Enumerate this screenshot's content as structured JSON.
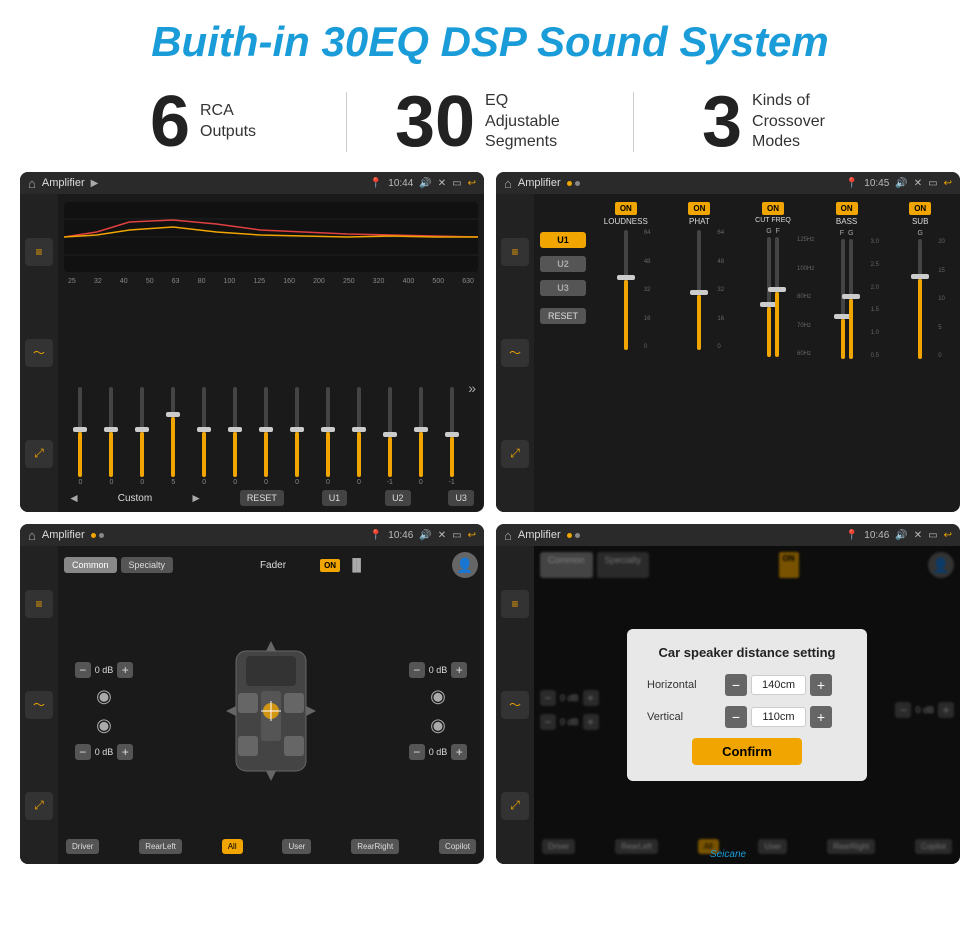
{
  "title": "Buith-in 30EQ DSP Sound System",
  "stats": [
    {
      "number": "6",
      "label": "RCA\nOutputs"
    },
    {
      "number": "30",
      "label": "EQ Adjustable\nSegments"
    },
    {
      "number": "3",
      "label": "Kinds of\nCrossover Modes"
    }
  ],
  "screen1": {
    "status_title": "Amplifier",
    "time": "10:44",
    "freq_labels": [
      "25",
      "32",
      "40",
      "50",
      "63",
      "80",
      "100",
      "125",
      "160",
      "200",
      "250",
      "320",
      "400",
      "500",
      "630"
    ],
    "slider_values": [
      "0",
      "0",
      "0",
      "5",
      "0",
      "0",
      "0",
      "0",
      "0",
      "0",
      "-1",
      "0",
      "-1"
    ],
    "bottom_btns": [
      "RESET",
      "U1",
      "U2",
      "U3"
    ],
    "eq_label": "Custom"
  },
  "screen2": {
    "status_title": "Amplifier",
    "time": "10:45",
    "u_labels": [
      "U1",
      "U2",
      "U3"
    ],
    "params": [
      "LOUDNESS",
      "PHAT",
      "CUT FREQ",
      "BASS",
      "SUB"
    ],
    "reset_label": "RESET"
  },
  "screen3": {
    "status_title": "Amplifier",
    "time": "10:46",
    "tabs": [
      "Common",
      "Specialty"
    ],
    "fader_label": "Fader",
    "on_label": "ON",
    "zones": [
      "Driver",
      "RearLeft",
      "All",
      "User",
      "RearRight",
      "Copilot"
    ],
    "vol_labels": [
      "0 dB",
      "0 dB",
      "0 dB",
      "0 dB"
    ]
  },
  "screen4": {
    "status_title": "Amplifier",
    "time": "10:46",
    "dialog_title": "Car speaker distance setting",
    "horizontal_label": "Horizontal",
    "horizontal_value": "140cm",
    "vertical_label": "Vertical",
    "vertical_value": "110cm",
    "confirm_label": "Confirm",
    "zones": [
      "Driver",
      "RearLeft",
      "All",
      "User",
      "RearRight",
      "Copilot"
    ],
    "vol_labels": [
      "0 dB",
      "0 dB"
    ]
  },
  "watermark": "Seicane"
}
